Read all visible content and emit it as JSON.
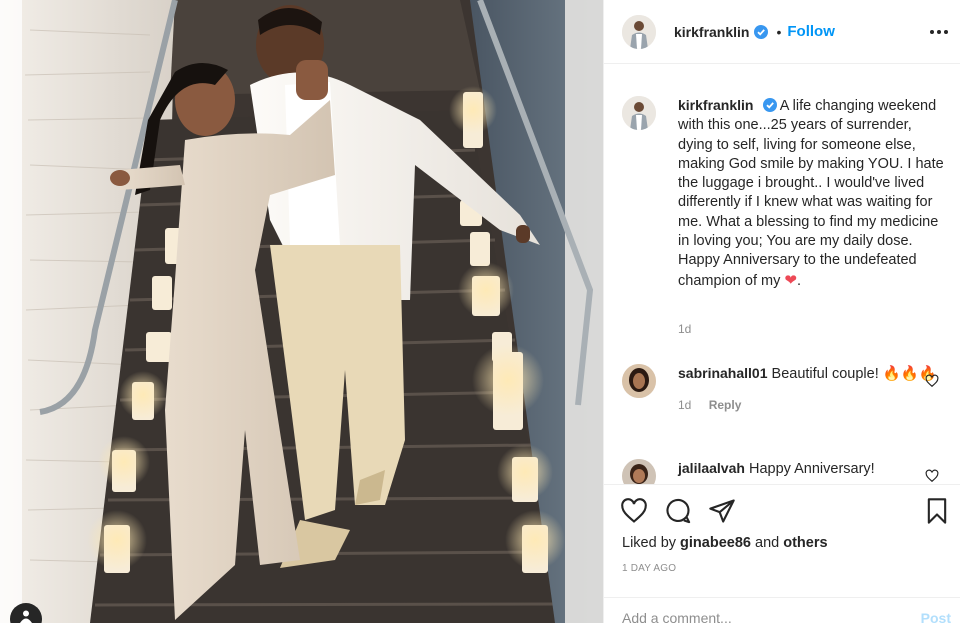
{
  "post": {
    "author": "kirkfranklin",
    "follow_label": "Follow",
    "separator": "•",
    "caption": "A life changing weekend with this one...25 years of surrender, dying to self, living for someone else, making God smile by making YOU. I hate the luggage i brought.. I would've lived differently if I knew what was waiting for me. What a blessing to find my medicine in loving you; You are my daily dose. Happy Anniversary to the undefeated champion of my",
    "caption_end": ".",
    "caption_time": "1d"
  },
  "comments": [
    {
      "user": "sabrinahall01",
      "text": "Beautiful couple! 🔥🔥🔥",
      "time": "1d",
      "reply_label": "Reply"
    },
    {
      "user": "jalilaalvah",
      "text": "Happy Anniversary!"
    }
  ],
  "likes": {
    "prefix": "Liked by",
    "user": "ginabee86",
    "connector": "and",
    "others": "others"
  },
  "timestamp": "1 DAY AGO",
  "add_comment": {
    "placeholder": "Add a comment...",
    "post_label": "Post"
  },
  "colors": {
    "accent": "#0095f6",
    "verified": "#3897f0",
    "heart": "#ed4956",
    "post_disabled": "#b2dffc"
  },
  "icons": [
    "verified-icon",
    "more-icon",
    "heart-icon",
    "comment-icon",
    "share-icon",
    "bookmark-icon",
    "user-tag-icon"
  ]
}
